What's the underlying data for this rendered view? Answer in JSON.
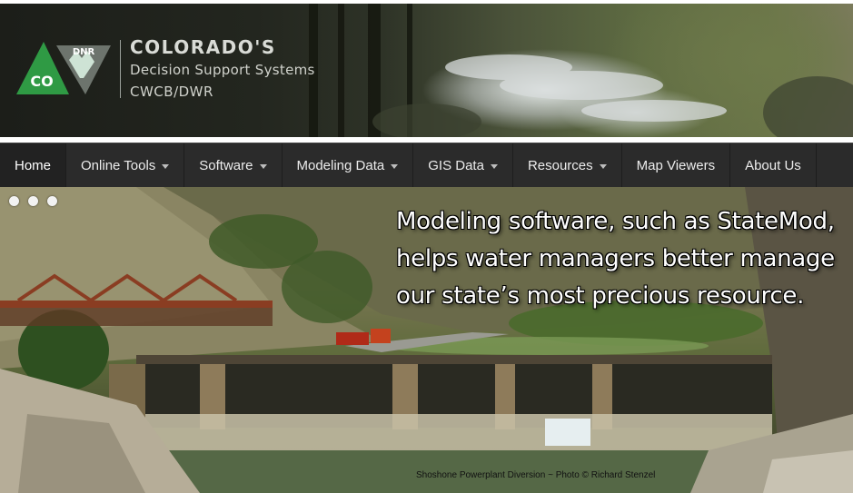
{
  "header": {
    "logo": {
      "co_text": "CO",
      "dnr_text": "DNR"
    },
    "title": "COLORADO'S",
    "subtitle": "Decision Support Systems",
    "org": "CWCB/DWR"
  },
  "nav": {
    "items": [
      {
        "label": "Home",
        "active": true,
        "dropdown": false
      },
      {
        "label": "Online Tools",
        "dropdown": true
      },
      {
        "label": "Software",
        "dropdown": true
      },
      {
        "label": "Modeling Data",
        "dropdown": true
      },
      {
        "label": "GIS Data",
        "dropdown": true
      },
      {
        "label": "Resources",
        "dropdown": true
      },
      {
        "label": "Map Viewers",
        "dropdown": false
      },
      {
        "label": "About Us",
        "dropdown": false
      }
    ]
  },
  "hero": {
    "caption_lines": [
      "Modeling software, such as StateMod,",
      "helps water managers better manage",
      "our state’s most precious resource."
    ],
    "photo_credit": "Shoshone Powerplant Diversion  ~ Photo © Richard Stenzel",
    "slide_count": 3
  },
  "colors": {
    "logo_green": "#2f9a44",
    "logo_gray": "#6d746d",
    "nav_bg": "#2b2b2b",
    "nav_text": "#ececec"
  }
}
